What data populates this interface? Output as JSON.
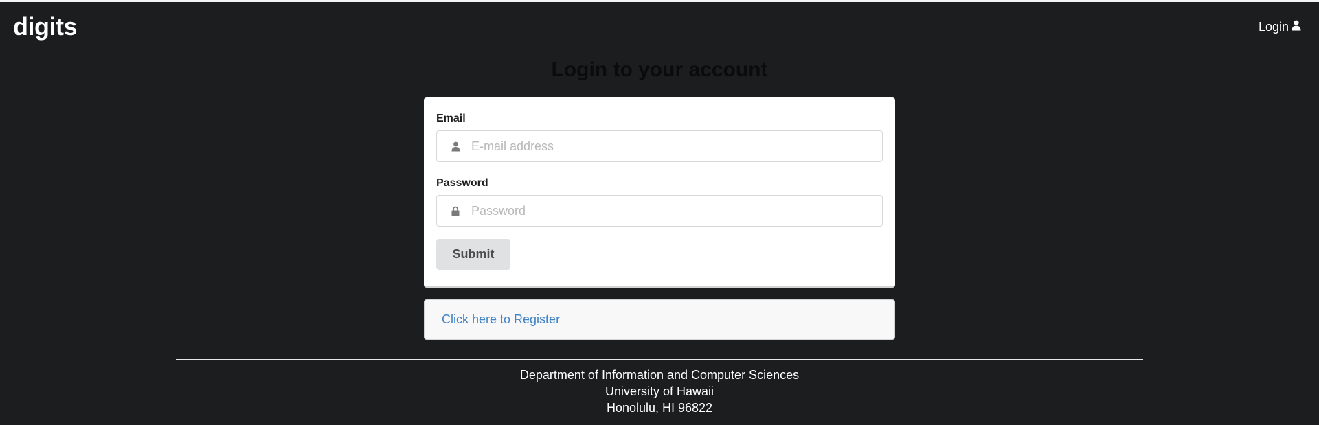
{
  "navbar": {
    "brand": "digits",
    "login_label": "Login"
  },
  "page_title": "Login to your account",
  "form": {
    "email": {
      "label": "Email",
      "placeholder": "E-mail address",
      "value": ""
    },
    "password": {
      "label": "Password",
      "placeholder": "Password",
      "value": ""
    },
    "submit_label": "Submit"
  },
  "register": {
    "link_text": "Click here to Register"
  },
  "footer": {
    "line1": "Department of Information and Computer Sciences",
    "line2": "University of Hawaii",
    "line3": "Honolulu, HI 96822"
  },
  "colors": {
    "background": "#1c1d1f",
    "card": "#ffffff",
    "link": "#4183c4",
    "button": "#e0e1e2"
  },
  "icons": {
    "user": "user-icon",
    "lock": "lock-icon"
  }
}
